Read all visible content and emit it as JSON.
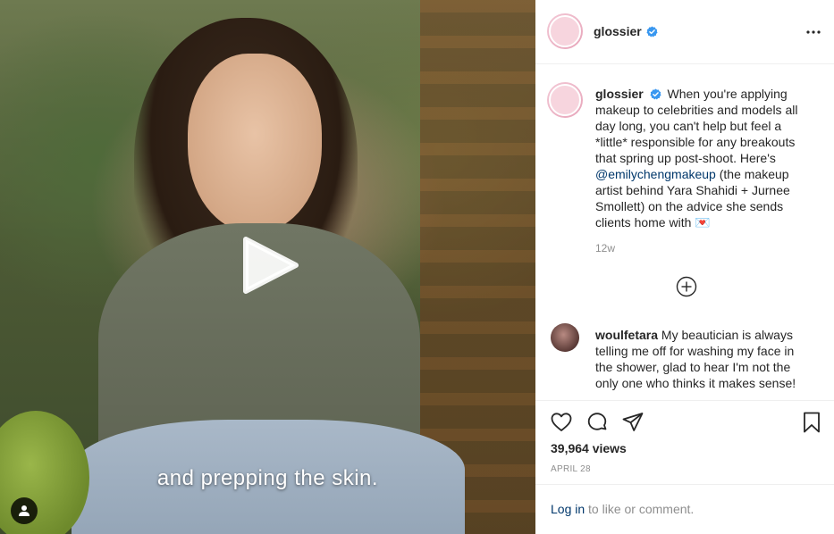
{
  "account": {
    "username": "glossier",
    "verified": true
  },
  "video": {
    "caption": "and prepping the skin."
  },
  "post": {
    "username": "glossier",
    "text_before_mention": "When you're applying makeup to celebrities and models all day long, you can't help but feel a *little* responsible for any breakouts that spring up post-shoot. Here's",
    "mention": "@emilychengmakeup",
    "text_after_mention": "(the makeup artist behind Yara Shahidi + Jurnee Smollett) on the advice she sends clients home with",
    "emoji": "💌",
    "time": "12w"
  },
  "comment": {
    "username": "woulfetara",
    "text": "My beautician is always telling me off for washing my face in the shower, glad to hear I'm not the only one who thinks it makes sense!"
  },
  "stats": {
    "views": "39,964 views",
    "date": "APRIL 28"
  },
  "login": {
    "link": "Log in",
    "rest": "to like or comment."
  },
  "icons": {
    "verified": "verified-badge-icon",
    "more": "more-options-icon",
    "play": "play-icon",
    "tag": "user-tag-icon",
    "load_more": "load-more-comments-icon",
    "like": "heart-icon",
    "comment": "comment-bubble-icon",
    "share": "paper-plane-icon",
    "save": "bookmark-icon"
  },
  "colors": {
    "verified_blue": "#3897f0",
    "link_blue": "#00376b",
    "muted_gray": "#8e8e8e"
  }
}
